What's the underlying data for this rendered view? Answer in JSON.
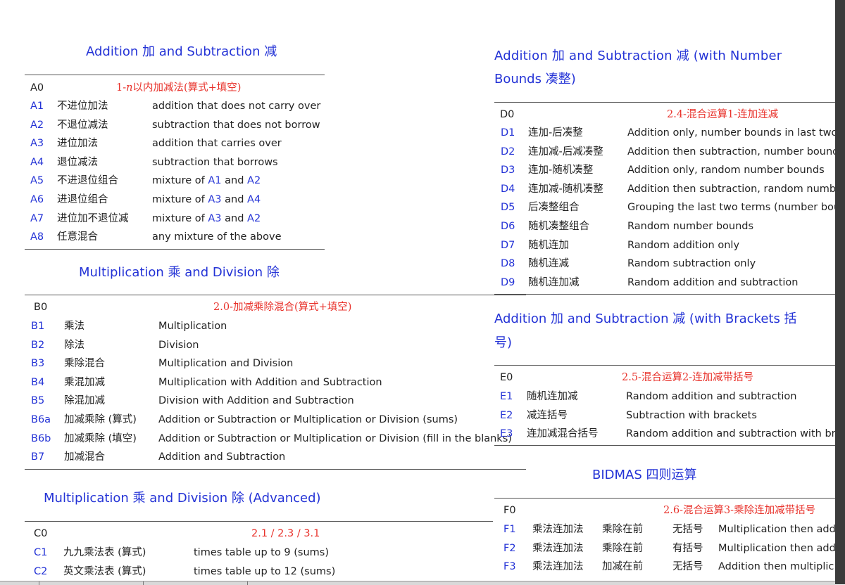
{
  "sections": {
    "A": {
      "title": "Addition 加 and Subtraction 减",
      "header": {
        "code": "A0",
        "subtitle_prefix": "1-",
        "subtitle_n": "n",
        "subtitle_rest": "以内加减法(算式+填空)"
      },
      "rows": [
        {
          "code": "A1",
          "cn": "不进位加法",
          "en": "addition that does not carry over"
        },
        {
          "code": "A2",
          "cn": "不退位减法",
          "en": "subtraction that does not borrow"
        },
        {
          "code": "A3",
          "cn": "进位加法",
          "en": "addition that carries over"
        },
        {
          "code": "A4",
          "cn": "退位减法",
          "en": "subtraction that borrows"
        },
        {
          "code": "A5",
          "cn": "不进退位组合",
          "en_pre": "mixture of ",
          "ref1": "A1",
          "en_mid": " and ",
          "ref2": "A2"
        },
        {
          "code": "A6",
          "cn": "进退位组合",
          "en_pre": "mixture of ",
          "ref1": "A3",
          "en_mid": " and ",
          "ref2": "A4"
        },
        {
          "code": "A7",
          "cn": "进位加不退位减",
          "en_pre": "mixture of ",
          "ref1": "A3",
          "en_mid": " and ",
          "ref2": "A2"
        },
        {
          "code": "A8",
          "cn": "任意混合",
          "en": "any mixture of the above"
        }
      ]
    },
    "B": {
      "title": "Multiplication 乘 and Division 除",
      "header": {
        "code": "B0",
        "subtitle": "2.0-加减乘除混合(算式+填空)"
      },
      "rows": [
        {
          "code": "B1",
          "cn": "乘法",
          "en": "Multiplication"
        },
        {
          "code": "B2",
          "cn": "除法",
          "en": "Division"
        },
        {
          "code": "B3",
          "cn": "乘除混合",
          "en": "Multiplication and Division"
        },
        {
          "code": "B4",
          "cn": "乘混加减",
          "en": "Multiplication with Addition and Subtraction"
        },
        {
          "code": "B5",
          "cn": "除混加减",
          "en": "Division with Addition and Subtraction"
        },
        {
          "code": "B6a",
          "cn": "加减乘除 (算式)",
          "en": "Addition or Subtraction or Multiplication or Division (sums)"
        },
        {
          "code": "B6b",
          "cn": "加减乘除 (填空)",
          "en": "Addition or Subtraction or Multiplication or Division (fill in the blanks)"
        },
        {
          "code": "B7",
          "cn": "加减混合",
          "en": "Addition and Subtraction"
        }
      ]
    },
    "C": {
      "title": "Multiplication 乘 and Division 除 (Advanced)",
      "header": {
        "code": "C0",
        "subtitle": "2.1 / 2.3 / 3.1"
      },
      "rows": [
        {
          "code": "C1",
          "cn": "九九乘法表 (算式)",
          "en": "times table up to 9 (sums)"
        },
        {
          "code": "C2",
          "cn": "英文乘法表 (算式)",
          "en": "times table up to 12 (sums)"
        }
      ]
    },
    "D": {
      "title_line1": "Addition  加  and  Subtraction  减  (with  Number",
      "title_line2": "Bounds 凑整)",
      "header": {
        "code": "D0",
        "subtitle": "2.4-混合运算1-连加连减"
      },
      "rows": [
        {
          "code": "D1",
          "cn": "连加-后凑整",
          "en": "Addition only, number bounds in last two"
        },
        {
          "code": "D2",
          "cn": "连加减-后减凑整",
          "en": "Addition then subtraction, number bounds"
        },
        {
          "code": "D3",
          "cn": "连加-随机凑整",
          "en": "Addition only, random number bounds"
        },
        {
          "code": "D4",
          "cn": "连加减-随机凑整",
          "en": "Addition then subtraction, random numbe"
        },
        {
          "code": "D5",
          "cn": "后凑整组合",
          "en": "Grouping the last two terms (number bou"
        },
        {
          "code": "D6",
          "cn": "随机凑整组合",
          "en": "Random number bounds"
        },
        {
          "code": "D7",
          "cn": "随机连加",
          "en": "Random addition only"
        },
        {
          "code": "D8",
          "cn": "随机连减",
          "en": "Random subtraction only"
        },
        {
          "code": "D9",
          "cn": "随机连加减",
          "en": "Random addition and subtraction"
        }
      ]
    },
    "E": {
      "title_line1": "Addition  加  and  Subtraction  减  (with  Brackets  括",
      "title_line2": "号)",
      "header": {
        "code": "E0",
        "subtitle": "2.5-混合运算2-连加减带括号"
      },
      "rows": [
        {
          "code": "E1",
          "cn": "随机连加减",
          "en": "Random addition and subtraction"
        },
        {
          "code": "E2",
          "cn": "减连括号",
          "en": "Subtraction with brackets"
        },
        {
          "code": "E3",
          "cn": "连加减混合括号",
          "en": "Random addition and subtraction with bra"
        }
      ]
    },
    "F": {
      "title": "BIDMAS 四则运算",
      "header": {
        "code": "F0",
        "subtitle": "2.6-混合运算3-乘除连加减带括号"
      },
      "rows": [
        {
          "code": "F1",
          "c1": "乘法连加法",
          "c2": "乘除在前",
          "c3": "无括号",
          "en": "Multiplication then add"
        },
        {
          "code": "F2",
          "c1": "乘法连加法",
          "c2": "乘除在前",
          "c3": "有括号",
          "en": "Multiplication then add"
        },
        {
          "code": "F3",
          "c1": "乘法连加法",
          "c2": "加减在前",
          "c3": "无括号",
          "en": "Addition then multiplic"
        }
      ]
    }
  },
  "colors": {
    "link": "#2433d6",
    "subhead": "#e8322b",
    "rule": "#555555",
    "scrollbar": "#3b3b3b"
  }
}
